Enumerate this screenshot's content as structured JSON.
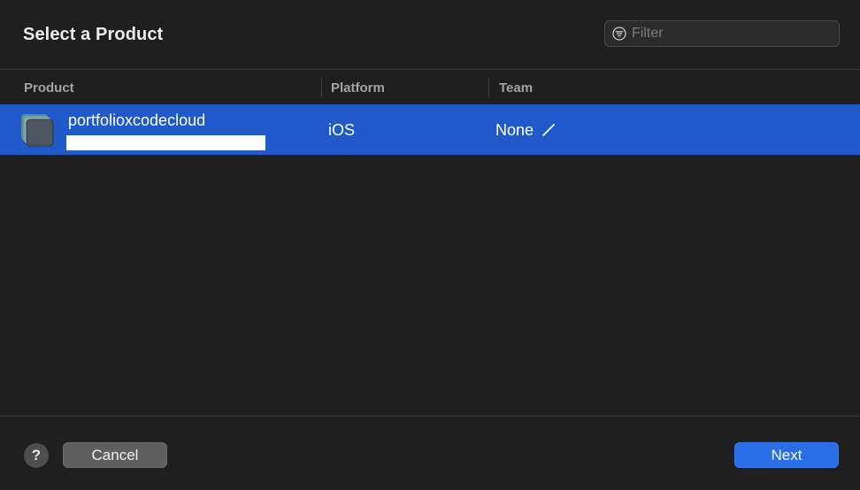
{
  "dialog": {
    "title": "Select a Product"
  },
  "filter": {
    "placeholder": "Filter",
    "value": "",
    "icon": "filter-icon"
  },
  "columns": {
    "product": "Product",
    "platform": "Platform",
    "team": "Team"
  },
  "rows": [
    {
      "name": "portfolioxcodecloud",
      "platform": "iOS",
      "team": "None",
      "selected": true,
      "icon": "app-stack-icon",
      "edit_icon": "pencil-icon"
    }
  ],
  "footer": {
    "help_label": "?",
    "cancel_label": "Cancel",
    "next_label": "Next"
  },
  "colors": {
    "background": "#1f1f1f",
    "selection": "#2059c9",
    "primary_button": "#2a6ee6"
  }
}
